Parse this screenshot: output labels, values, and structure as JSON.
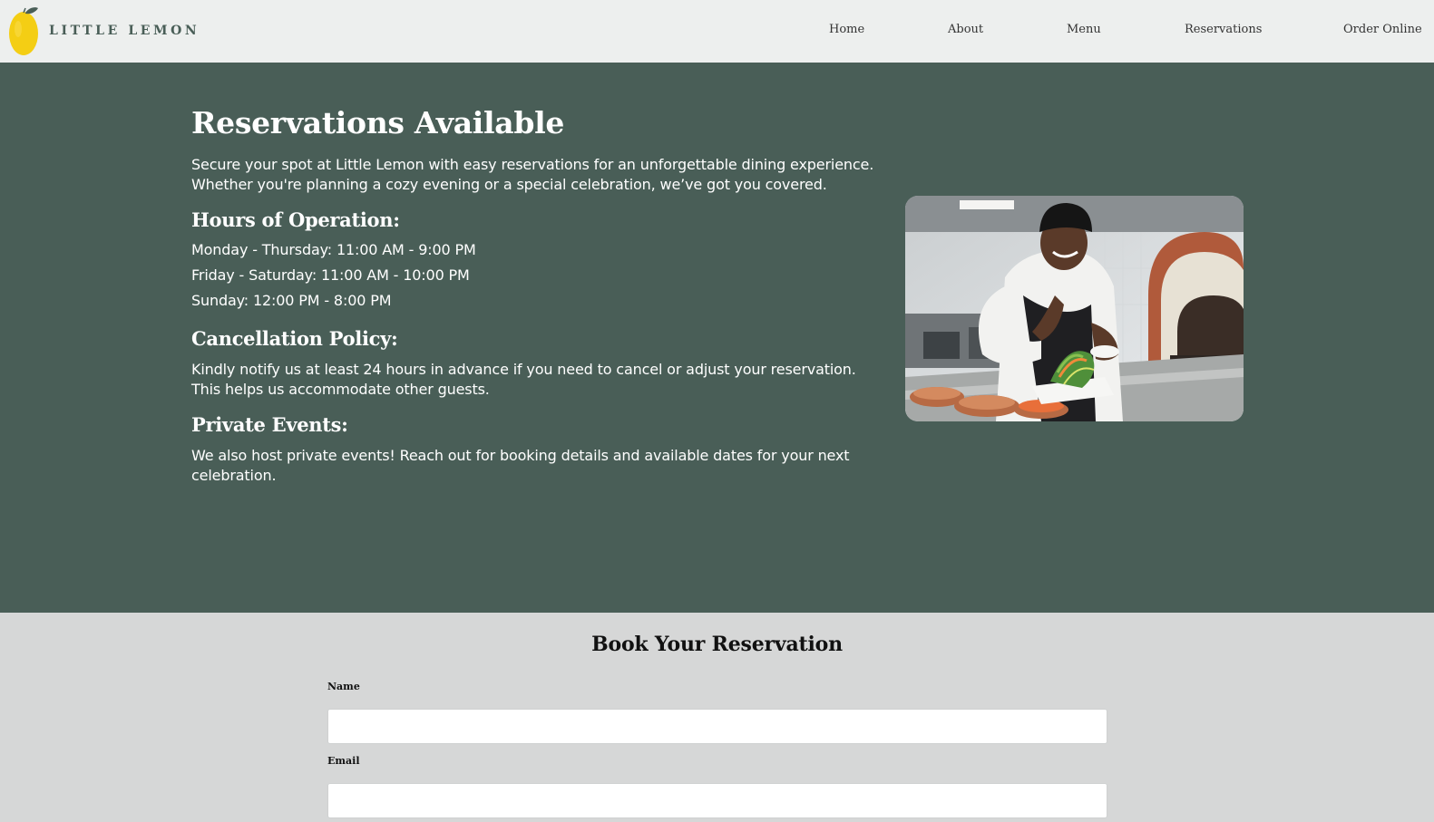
{
  "brand": {
    "name": "LITTLE LEMON",
    "colors": {
      "primary": "#495e57",
      "accent": "#f4ce14",
      "header_bg": "#edefee"
    }
  },
  "nav": {
    "items": [
      {
        "label": "Home"
      },
      {
        "label": "About"
      },
      {
        "label": "Menu"
      },
      {
        "label": "Reservations"
      },
      {
        "label": "Order Online"
      }
    ]
  },
  "hero": {
    "title": "Reservations Available",
    "intro": "Secure your spot at Little Lemon with easy reservations for an unforgettable dining experience. Whether you're planning a cozy evening or a special celebration, we’ve got you covered.",
    "hours_heading": "Hours of Operation:",
    "hours": [
      "Monday - Thursday: 11:00 AM - 9:00 PM",
      "Friday - Saturday: 11:00 AM - 10:00 PM",
      "Sunday: 12:00 PM - 8:00 PM"
    ],
    "cancellation_heading": "Cancellation Policy:",
    "cancellation_text": "Kindly notify us at least 24 hours in advance if you need to cancel or adjust your reservation. This helps us accommodate other guests.",
    "private_heading": "Private Events:",
    "private_text": "We also host private events! Reach out for booking details and available dates for your next celebration.",
    "image_icon": "chef-plating-salad-photo"
  },
  "booking": {
    "title": "Book Your Reservation",
    "fields": [
      {
        "label": "Name",
        "value": "",
        "placeholder": ""
      },
      {
        "label": "Email",
        "value": "",
        "placeholder": ""
      }
    ]
  }
}
